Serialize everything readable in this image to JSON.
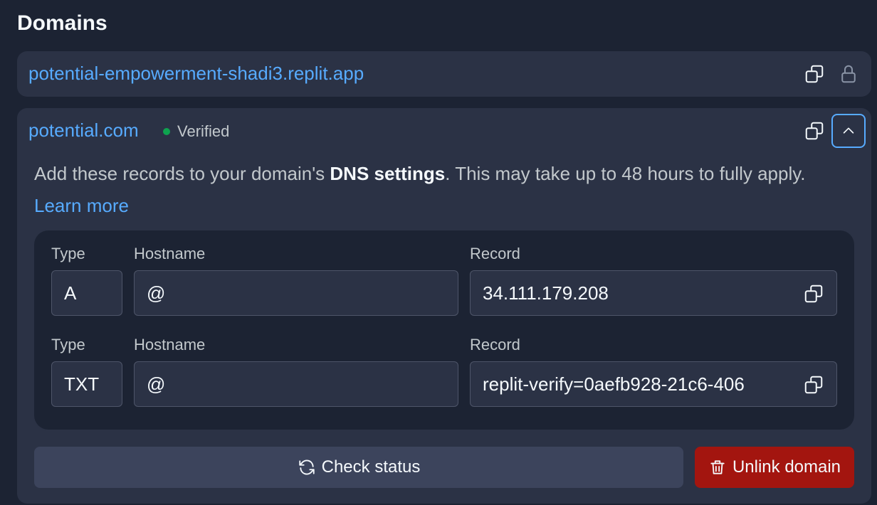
{
  "page": {
    "title": "Domains"
  },
  "domains": [
    {
      "name": "potential-empowerment-shadi3.replit.app"
    },
    {
      "name": "potential.com",
      "status": "Verified",
      "description": {
        "before": "Add these records to your domain's ",
        "bold": "DNS settings",
        "after": ". This may take up to 48 hours to fully apply. ",
        "link": "Learn more"
      },
      "records": [
        {
          "type_label": "Type",
          "hostname_label": "Hostname",
          "record_label": "Record",
          "type": "A",
          "hostname": "@",
          "record": "34.111.179.208"
        },
        {
          "type_label": "Type",
          "hostname_label": "Hostname",
          "record_label": "Record",
          "type": "TXT",
          "hostname": "@",
          "record": "replit-verify=0aefb928-21c6-406"
        }
      ],
      "check_status_label": "Check status",
      "unlink_label": "Unlink domain"
    }
  ],
  "colors": {
    "accent": "#57abff",
    "verified": "#0ea34f",
    "danger": "#a3150f"
  },
  "icons": [
    "copy-icon",
    "lock-icon",
    "chevron-up-icon",
    "refresh-icon",
    "trash-icon"
  ]
}
